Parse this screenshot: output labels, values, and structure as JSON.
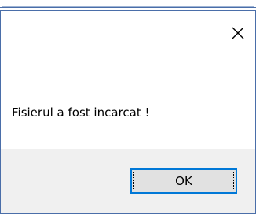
{
  "dialog": {
    "message": "Fisierul a fost incarcat !",
    "ok_label": "OK",
    "close_icon": "close-icon"
  },
  "colors": {
    "accent": "#0078d7",
    "frame": "#4a6ea9",
    "footer": "#f0f0f0",
    "button": "#e1e1e1"
  }
}
